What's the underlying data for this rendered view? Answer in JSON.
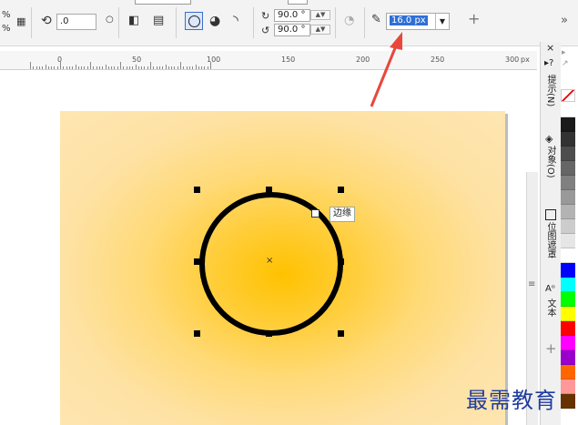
{
  "toolbar": {
    "percent_top": "%",
    "percent_bottom": "%",
    "rotation_value": ".0",
    "angle_start": "90.0 °",
    "angle_end": "90.0 °",
    "outline_width": "16.0 px",
    "add_symbol": "+",
    "more_symbol": "»"
  },
  "ruler": {
    "labels": [
      "0",
      "50",
      "100",
      "150",
      "200",
      "250",
      "300"
    ],
    "unit": "px"
  },
  "canvas": {
    "tooltip": "边缘",
    "center_mark": "×"
  },
  "side_panel": {
    "close": "×",
    "tabs": [
      "提示(N)",
      "对象(O)",
      "位图遮罩",
      "文本"
    ],
    "scroll_mark": "≡",
    "add": "+"
  },
  "palette": {
    "colors": [
      "#ffffff",
      "#1a1a1a",
      "#333333",
      "#4d4d4d",
      "#666666",
      "#808080",
      "#999999",
      "#b3b3b3",
      "#cccccc",
      "#e6e6e6",
      "#ffffff",
      "#0000ff",
      "#00ffff",
      "#00ff00",
      "#ffff00",
      "#ff0000",
      "#ff00ff",
      "#9900cc",
      "#ff6600",
      "#ff9999",
      "#663300"
    ]
  },
  "watermark": "最需教育",
  "colors": {
    "accent": "#2f6fd6",
    "arrow": "#e8483a",
    "page_center": "#ffc200"
  }
}
